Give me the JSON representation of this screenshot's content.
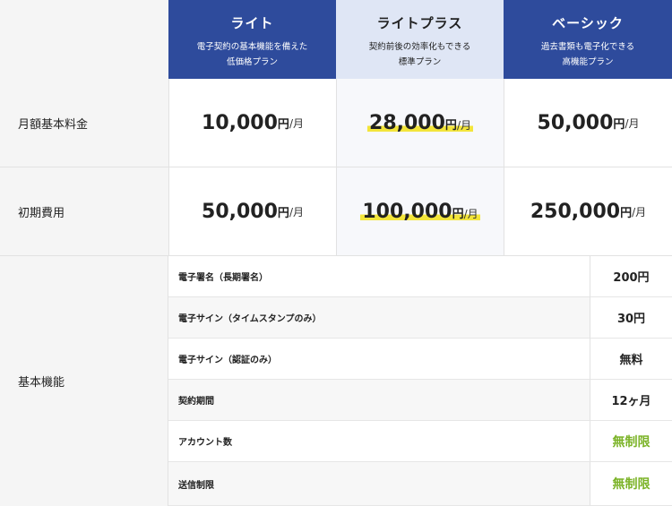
{
  "plans": [
    {
      "name": "ライト",
      "desc_line1": "電子契約の基本機能を備えた",
      "desc_line2": "低価格プラン"
    },
    {
      "name": "ライトプラス",
      "desc_line1": "契約前後の効率化もできる",
      "desc_line2": "標準プラン"
    },
    {
      "name": "ベーシック",
      "desc_line1": "過去書類も電子化できる",
      "desc_line2": "高機能プラン"
    }
  ],
  "rows": {
    "monthly": {
      "label": "月額基本料金",
      "values": [
        "10,000",
        "28,000",
        "50,000"
      ]
    },
    "initial": {
      "label": "初期費用",
      "values": [
        "50,000",
        "100,000",
        "250,000"
      ]
    }
  },
  "units": {
    "yen": "円",
    "per_month": "/月"
  },
  "features": {
    "label": "基本機能",
    "items": [
      {
        "name": "電子署名（長期署名）",
        "value": "200円"
      },
      {
        "name": "電子サイン（タイムスタンプのみ）",
        "value": "30円"
      },
      {
        "name": "電子サイン（認証のみ）",
        "value": "無料"
      },
      {
        "name": "契約期間",
        "value": "12ヶ月"
      },
      {
        "name": "アカウント数",
        "value": "無制限"
      },
      {
        "name": "送信制限",
        "value": "無制限"
      }
    ]
  },
  "colors": {
    "header_blue": "#2e4b9c",
    "header_light": "#dfe6f5",
    "highlight": "#f3e53a",
    "unlimited_green": "#7bb327"
  }
}
